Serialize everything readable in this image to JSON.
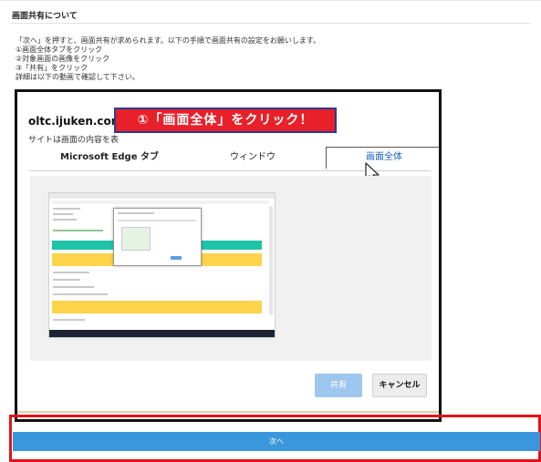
{
  "header": {
    "title": "画面共有について"
  },
  "instructions": {
    "lines": [
      "「次へ」を押すと、画面共有が求められます。以下の手順で画面共有の設定をお願いします。",
      "①画面全体タブをクリック",
      "②対象画面の画像をクリック",
      "③「共有」をクリック",
      "詳細は以下の動画で確認して下さい。"
    ]
  },
  "dialog": {
    "site_name": "oltc.ijuken.com と",
    "description": "サイトは画面の内容を表",
    "callout": "①「画面全体」をクリック！",
    "tabs": [
      "Microsoft Edge タブ",
      "ウィンドウ",
      "画面全体"
    ],
    "selected_tab": "画面全体",
    "share_button": "共有",
    "cancel_button": "キャンセル"
  },
  "next_button": "次へ",
  "colors": {
    "accent_blue": "#3a96dd",
    "highlight_red": "#e0141a",
    "callout_red": "#e8202a",
    "share_disabled": "#9dc7ee"
  }
}
